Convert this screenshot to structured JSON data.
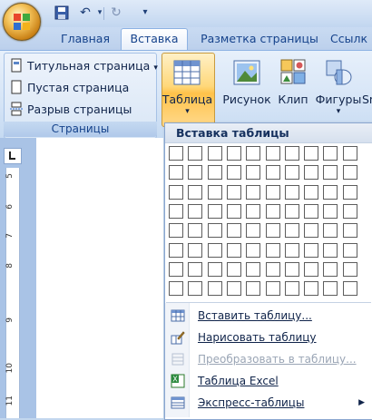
{
  "tabs": [
    "Главная",
    "Вставка",
    "Разметка страницы",
    "Ссылк"
  ],
  "active_tab": "Вставка",
  "pages_group": {
    "items": [
      "Титульная страница",
      "Пустая страница",
      "Разрыв страницы"
    ],
    "label": "Страницы"
  },
  "ribbon_buttons": {
    "table": "Таблица",
    "picture": "Рисунок",
    "clip": "Клип",
    "shapes": "Фигуры",
    "smartart": "Sn"
  },
  "ruler_numbers": [
    "5",
    "6",
    "7",
    "8",
    "9",
    "10",
    "11"
  ],
  "dropdown": {
    "header": "Вставка таблицы",
    "grid_cols": 10,
    "grid_rows": 8,
    "items": [
      {
        "label": "Вставить таблицу...",
        "enabled": true,
        "icon": "table-icon"
      },
      {
        "label": "Нарисовать таблицу",
        "enabled": true,
        "icon": "pencil-icon"
      },
      {
        "label": "Преобразовать в таблицу...",
        "enabled": false,
        "icon": "convert-icon"
      },
      {
        "label": "Таблица Excel",
        "enabled": true,
        "icon": "excel-icon"
      },
      {
        "label": "Экспресс-таблицы",
        "enabled": true,
        "icon": "quick-tables-icon",
        "submenu": true
      }
    ]
  }
}
